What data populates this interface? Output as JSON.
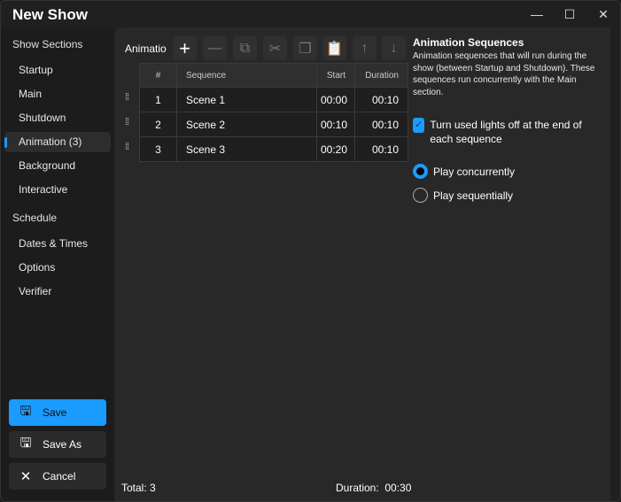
{
  "window": {
    "title": "New Show",
    "minimize": "—",
    "maximize": "☐",
    "close": "✕"
  },
  "sidebar": {
    "section_header": "Show Sections",
    "items": [
      {
        "label": "Startup"
      },
      {
        "label": "Main"
      },
      {
        "label": "Shutdown"
      },
      {
        "label": "Animation (3)"
      },
      {
        "label": "Background"
      },
      {
        "label": "Interactive"
      }
    ],
    "schedule_header": "Schedule",
    "schedule_items": [
      {
        "label": "Dates & Times"
      },
      {
        "label": "Options"
      },
      {
        "label": "Verifier"
      }
    ],
    "save_label": "Save",
    "save_as_label": "Save As",
    "cancel_label": "Cancel"
  },
  "toolbar": {
    "label": "Animatio"
  },
  "table": {
    "headers": [
      "#",
      "Sequence",
      "Start",
      "Duration"
    ],
    "rows": [
      {
        "num": "1",
        "sequence": "Scene 1",
        "start": "00:00",
        "duration": "00:10"
      },
      {
        "num": "2",
        "sequence": "Scene 2",
        "start": "00:10",
        "duration": "00:10"
      },
      {
        "num": "3",
        "sequence": "Scene 3",
        "start": "00:20",
        "duration": "00:10"
      }
    ]
  },
  "footer": {
    "total": "Total: 3",
    "duration": "Duration:  00:30"
  },
  "panel": {
    "title": "Animation Sequences",
    "description": "Animation sequences that will run during the show (between Startup and Shutdown). These sequences run concurrently with the Main section.",
    "checkbox_label": "Turn used lights off at the end of each sequence",
    "checkbox_checked": true,
    "radio_concurrent": "Play concurrently",
    "radio_sequential": "Play sequentially",
    "selected_mode": "concurrent"
  },
  "colors": {
    "accent": "#1a9bff"
  }
}
